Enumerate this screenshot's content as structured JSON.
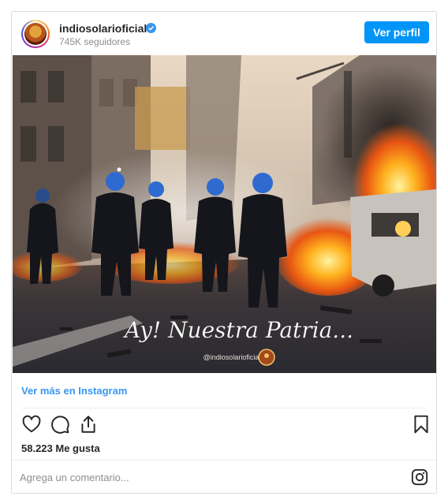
{
  "header": {
    "username": "indiosolarioficial",
    "followers": "745K seguidores",
    "view_profile_label": "Ver perfil"
  },
  "post": {
    "overlay_text": "Ay! Nuestra Patria...",
    "watermark": "@indiosolarioficial",
    "view_more_label": "Ver más en Instagram",
    "likes": "58.223 Me gusta"
  },
  "comment": {
    "placeholder": "Agrega un comentario..."
  },
  "icons": {
    "like": "heart-icon",
    "comment": "comment-icon",
    "share": "share-icon",
    "save": "bookmark-icon",
    "instagram": "instagram-icon",
    "verified": "verified-badge-icon"
  },
  "colors": {
    "accent": "#0095f6",
    "link": "#3897f0",
    "fire": "#ff7a1a"
  }
}
